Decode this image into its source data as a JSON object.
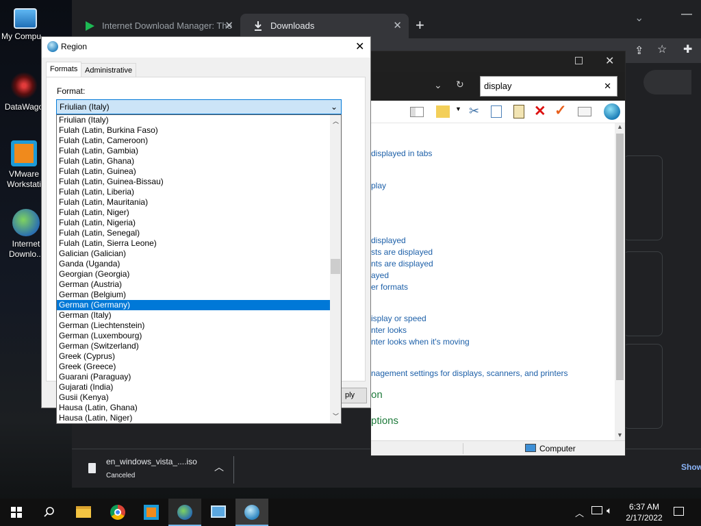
{
  "desktop": {
    "icons": [
      {
        "label": "My Compu",
        "icon": "computer-icon"
      },
      {
        "label": "DataWago",
        "icon": "datawagon-icon"
      },
      {
        "label": "VMware",
        "label2": "Workstati",
        "icon": "vmware-icon"
      },
      {
        "label": "Internet",
        "label2": "Downlo...",
        "icon": "idm-icon"
      }
    ]
  },
  "chrome": {
    "tabs": [
      {
        "label": "Internet Download Manager: The",
        "icon": "idm-play-icon"
      },
      {
        "label": "Downloads",
        "icon": "download-icon"
      }
    ],
    "new_tab": "+",
    "shelf": {
      "filename": "en_windows_vista_....iso",
      "status": "Canceled",
      "show_all": "Show"
    }
  },
  "explorer": {
    "search_value": "display",
    "links": [
      "displayed in tabs",
      "play",
      "displayed",
      "sts are displayed",
      "nts are displayed",
      "ayed",
      "er formats",
      "isplay or speed",
      "nter looks",
      "nter looks when it's moving",
      "nagement settings for displays, scanners, and printers"
    ],
    "green_items": [
      "on",
      "ptions"
    ],
    "status_computer": "Computer"
  },
  "region": {
    "title": "Region",
    "tabs": [
      "Formats",
      "Administrative"
    ],
    "format_label": "Format:",
    "format_selected": "Friulian (Italy)",
    "apply_fragment": "ply",
    "format_options": [
      "Friulian (Italy)",
      "Fulah (Latin, Burkina Faso)",
      "Fulah (Latin, Cameroon)",
      "Fulah (Latin, Gambia)",
      "Fulah (Latin, Ghana)",
      "Fulah (Latin, Guinea)",
      "Fulah (Latin, Guinea-Bissau)",
      "Fulah (Latin, Liberia)",
      "Fulah (Latin, Mauritania)",
      "Fulah (Latin, Niger)",
      "Fulah (Latin, Nigeria)",
      "Fulah (Latin, Senegal)",
      "Fulah (Latin, Sierra Leone)",
      "Galician (Galician)",
      "Ganda (Uganda)",
      "Georgian (Georgia)",
      "German (Austria)",
      "German (Belgium)",
      "German (Germany)",
      "German (Italy)",
      "German (Liechtenstein)",
      "German (Luxembourg)",
      "German (Switzerland)",
      "Greek (Cyprus)",
      "Greek (Greece)",
      "Guarani (Paraguay)",
      "Gujarati (India)",
      "Gusii (Kenya)",
      "Hausa (Latin, Ghana)",
      "Hausa (Latin, Niger)"
    ],
    "highlighted_option": "German (Germany)"
  },
  "taskbar": {
    "apps": [
      "start-icon",
      "search-icon",
      "file-explorer-icon",
      "chrome-icon",
      "vmware-icon",
      "idm-icon",
      "control-panel-icon",
      "region-icon"
    ],
    "time": "6:37 AM",
    "date": "2/17/2022"
  },
  "colors": {
    "accent": "#0078d7",
    "link": "#1c5fa8",
    "taskbar": "#101010"
  }
}
